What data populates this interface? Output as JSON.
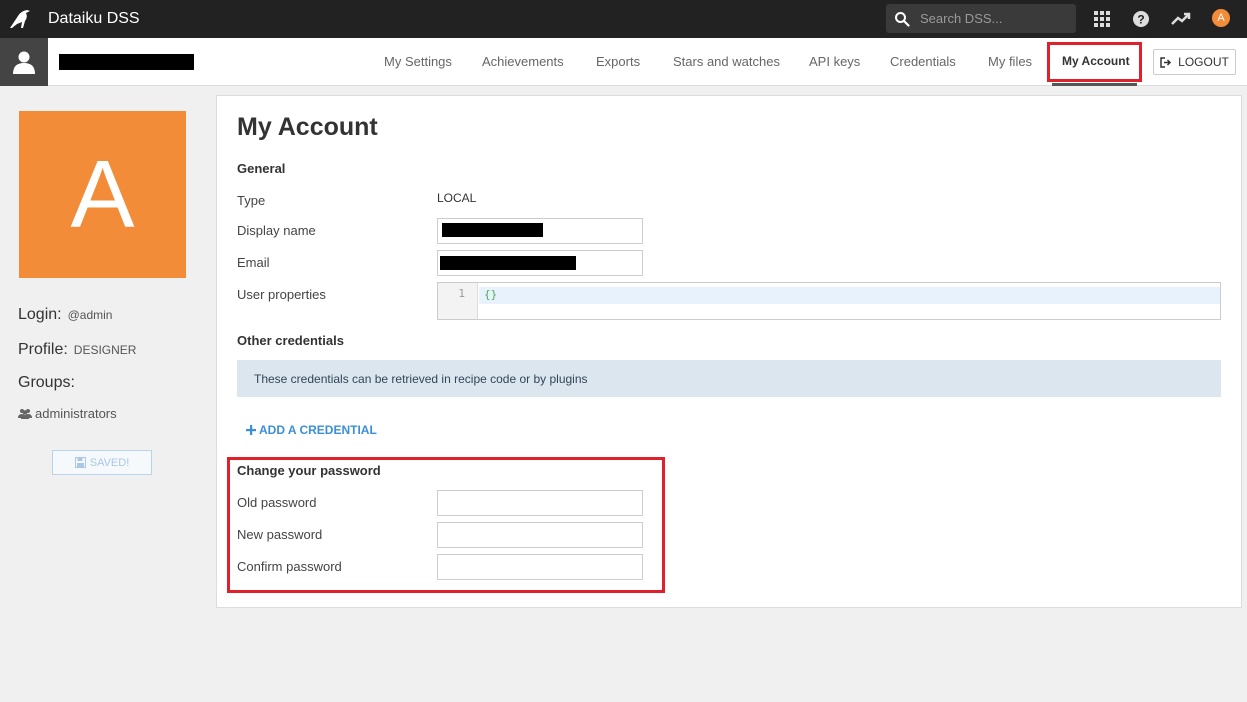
{
  "app": {
    "title": "Dataiku DSS"
  },
  "search": {
    "placeholder": "Search DSS..."
  },
  "topbar_icons": [
    "apps-grid-icon",
    "help-icon",
    "activity-icon"
  ],
  "user_avatar_letter": "A",
  "nav": {
    "tabs": [
      {
        "label": "My Settings"
      },
      {
        "label": "Achievements"
      },
      {
        "label": "Exports"
      },
      {
        "label": "Stars and watches"
      },
      {
        "label": "API keys"
      },
      {
        "label": "Credentials"
      },
      {
        "label": "My files"
      },
      {
        "label": "My Account"
      }
    ],
    "active_tab": "My Account",
    "logout_label": "LOGOUT"
  },
  "profile": {
    "avatar_letter": "A",
    "login_label": "Login:",
    "login_value": "@admin",
    "profile_label": "Profile:",
    "profile_value": "DESIGNER",
    "groups_label": "Groups:",
    "groups": [
      "administrators"
    ],
    "saved_label": "SAVED!"
  },
  "account": {
    "title": "My Account",
    "general_title": "General",
    "type_label": "Type",
    "type_value": "LOCAL",
    "display_name_label": "Display name",
    "email_label": "Email",
    "user_properties_label": "User properties",
    "user_properties_line": "1",
    "user_properties_value": "{}",
    "other_credentials_title": "Other credentials",
    "credentials_info": "These credentials can be retrieved in recipe code or by plugins",
    "add_credential_label": "ADD A CREDENTIAL",
    "change_password_title": "Change your password",
    "old_password_label": "Old password",
    "new_password_label": "New password",
    "confirm_password_label": "Confirm password"
  },
  "colors": {
    "topbar": "#222222",
    "accent_orange": "#f28c38",
    "highlight_red": "#e0202a",
    "link_blue": "#3b8fd6",
    "info_bg": "#dbe6ee"
  }
}
